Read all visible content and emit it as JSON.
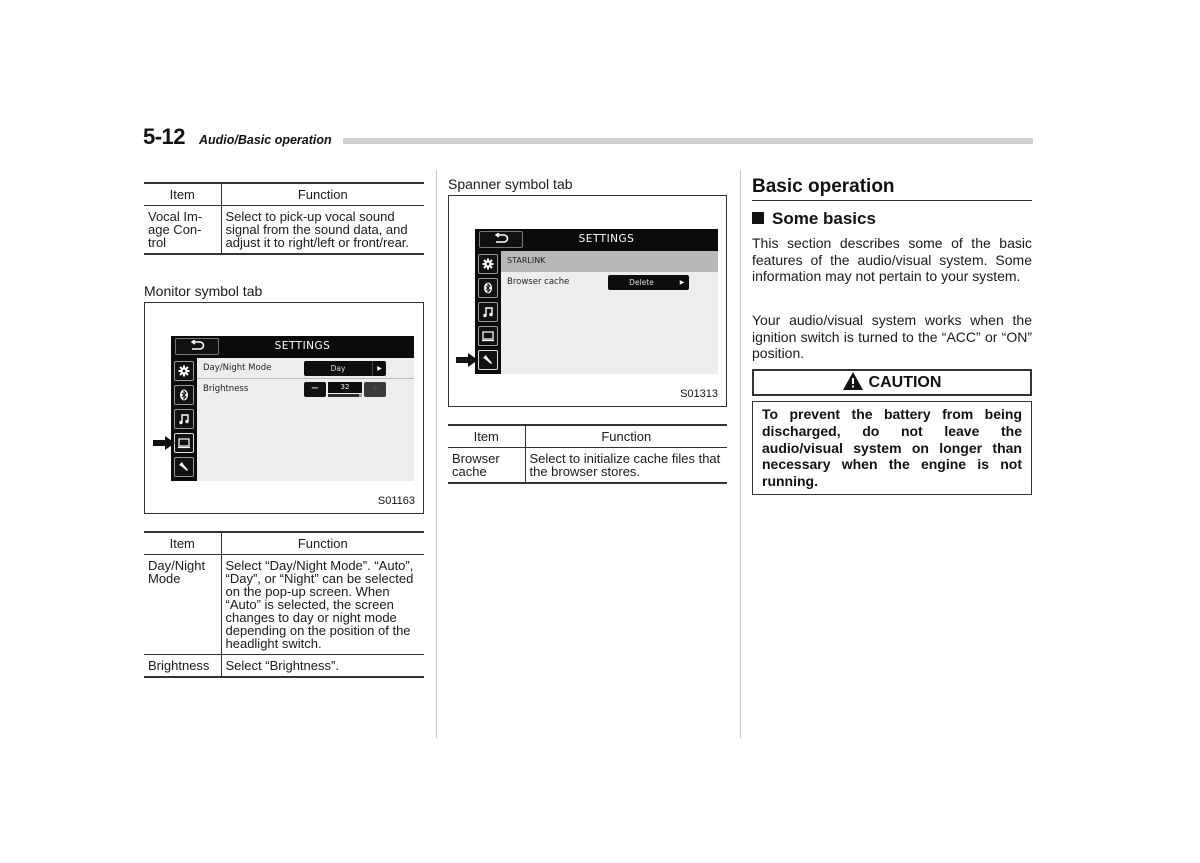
{
  "header": {
    "page_number": "5-12",
    "section": "Audio/Basic operation"
  },
  "left_column": {
    "table1": {
      "headers": [
        "Item",
        "Function"
      ],
      "rows": [
        {
          "item": "Vocal Im-\nage Con-\ntrol",
          "function": "Select to pick-up vocal sound signal from the sound data, and adjust it to right/left or front/rear."
        }
      ]
    },
    "monitor_caption": "Monitor symbol tab",
    "monitor_figure": {
      "back_label": "⮌",
      "title": "SETTINGS",
      "tabs": [
        "gear-icon",
        "bluetooth-icon",
        "music-icon",
        "monitor-icon",
        "spanner-icon"
      ],
      "active_tab": "monitor-icon",
      "rows": [
        {
          "label": "Day/Night Mode",
          "value": "Day",
          "arrow": "▶"
        },
        {
          "label": "Brightness",
          "minus": "−",
          "value": "32",
          "plus": "+",
          "level_fraction": 0.9
        }
      ],
      "code": "S01163"
    },
    "table2": {
      "headers": [
        "Item",
        "Function"
      ],
      "rows": [
        {
          "item": "Day/Night\nMode",
          "function": "Select “Day/Night Mode”. “Auto”, “Day”, or “Night” can be selected on the pop-up screen. When “Auto” is selected, the screen changes to day or night mode depending on the position of the headlight switch."
        },
        {
          "item": "Brightness",
          "function": "Select “Brightness”."
        }
      ]
    }
  },
  "middle_column": {
    "spanner_caption": "Spanner symbol tab",
    "spanner_figure": {
      "back_label": "⮌",
      "title": "SETTINGS",
      "tabs": [
        "gear-icon",
        "bluetooth-icon",
        "music-icon",
        "monitor-icon",
        "spanner-icon"
      ],
      "active_tab": "spanner-icon",
      "group_header": "STARLINK",
      "rows": [
        {
          "label": "Browser cache",
          "value": "Delete",
          "arrow": "▶"
        }
      ],
      "code": "S01313"
    },
    "table3": {
      "headers": [
        "Item",
        "Function"
      ],
      "rows": [
        {
          "item": "Browser\ncache",
          "function": "Select to initialize cache files that the browser stores."
        }
      ]
    }
  },
  "right_column": {
    "title": "Basic operation",
    "subtitle": "Some basics",
    "paragraphs": [
      "This section describes some of the basic features of the audio/visual system. Some information may not pertain to your system.",
      "Your audio/visual system works when the ignition switch is turned to the “ACC” or “ON” position."
    ],
    "caution": {
      "label": "CAUTION",
      "text": "To prevent the battery from being discharged, do not leave the audio/visual system on longer than necessary when the engine is not running."
    }
  }
}
